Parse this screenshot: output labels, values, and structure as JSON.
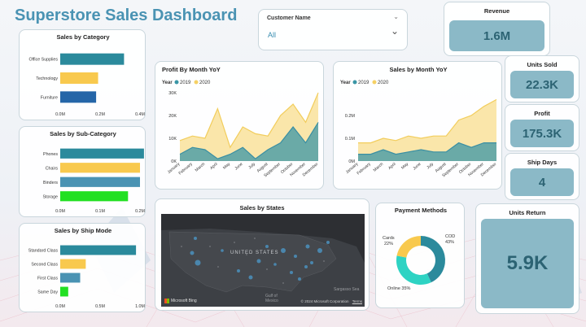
{
  "title": "Superstore Sales Dashboard",
  "filter": {
    "label": "Customer Name",
    "value": "All"
  },
  "kpis": {
    "revenue": {
      "label": "Revenue",
      "value": "1.6M"
    },
    "units_sold": {
      "label": "Units Sold",
      "value": "22.3K"
    },
    "profit": {
      "label": "Profit",
      "value": "175.3K"
    },
    "ship_days": {
      "label": "Ship Days",
      "value": "4"
    },
    "units_return": {
      "label": "Units Return",
      "value": "5.9K"
    }
  },
  "map": {
    "title": "Sales by States",
    "country_label": "UNITED STATES",
    "gulf_label": "Gulf of Mexico",
    "sea_label": "Sargasso Sea",
    "attribution": "© 2024 Microsoft Corporation",
    "terms": "Terms",
    "brand": "Microsoft Bing"
  },
  "colors": {
    "y2019": "#3a96a6",
    "y2020": "#f5d165",
    "teal": "#2b8a9c",
    "yellow": "#f8c94e",
    "blue": "#2566a8",
    "green": "#22e022",
    "accent": "#4a93b3"
  },
  "chart_data": [
    {
      "type": "bar",
      "orientation": "horizontal",
      "title": "Sales by Category",
      "categories": [
        "Office Supplies",
        "Technology",
        "Furniture"
      ],
      "values": [
        0.32,
        0.19,
        0.18
      ],
      "ticks": [
        "0.0M",
        "0.2M",
        "0.4M"
      ],
      "xlim": [
        0,
        0.4
      ]
    },
    {
      "type": "bar",
      "orientation": "horizontal",
      "title": "Sales by Sub-Category",
      "categories": [
        "Phones",
        "Chairs",
        "Binders",
        "Storage"
      ],
      "values": [
        0.21,
        0.2,
        0.2,
        0.17
      ],
      "ticks": [
        "0.0M",
        "0.1M",
        "0.2M"
      ],
      "xlim": [
        0,
        0.2
      ]
    },
    {
      "type": "bar",
      "orientation": "horizontal",
      "title": "Sales by Ship Mode",
      "categories": [
        "Standard Class",
        "Second Class",
        "First Class",
        "Same Day"
      ],
      "values": [
        0.95,
        0.32,
        0.25,
        0.1
      ],
      "ticks": [
        "0.0M",
        "0.5M",
        "1.0M"
      ],
      "xlim": [
        0,
        1
      ]
    },
    {
      "type": "area",
      "title": "Profit By Month YoY",
      "legend_title": "Year",
      "categories": [
        "January",
        "February",
        "March",
        "April",
        "May",
        "June",
        "July",
        "August",
        "September",
        "October",
        "November",
        "December"
      ],
      "series": [
        {
          "name": "2019",
          "values": [
            3000,
            6000,
            5000,
            1000,
            3000,
            6000,
            1000,
            5000,
            8000,
            15000,
            8000,
            17000
          ]
        },
        {
          "name": "2020",
          "values": [
            9000,
            11000,
            10000,
            23000,
            6000,
            15000,
            12000,
            11000,
            20000,
            25000,
            17000,
            30000
          ]
        }
      ],
      "ticks": [
        "0K",
        "10K",
        "20K",
        "30K"
      ],
      "ylim": [
        0,
        30000
      ]
    },
    {
      "type": "area",
      "title": "Sales by Month YoY",
      "legend_title": "Year",
      "categories": [
        "January",
        "February",
        "March",
        "April",
        "May",
        "June",
        "July",
        "August",
        "September",
        "October",
        "November",
        "December"
      ],
      "series": [
        {
          "name": "2019",
          "values": [
            30000,
            30000,
            50000,
            30000,
            40000,
            50000,
            40000,
            40000,
            80000,
            60000,
            80000,
            80000
          ]
        },
        {
          "name": "2020",
          "values": [
            80000,
            80000,
            100000,
            90000,
            110000,
            100000,
            110000,
            110000,
            180000,
            200000,
            240000,
            270000
          ]
        }
      ],
      "ticks": [
        "0M",
        "0.1M",
        "0.2M"
      ],
      "ylim": [
        0,
        300000
      ]
    },
    {
      "type": "pie",
      "donut": true,
      "title": "Payment Methods",
      "categories": [
        "COD",
        "Online",
        "Cards"
      ],
      "values": [
        43,
        35,
        22
      ],
      "labels": [
        "COD 43%",
        "Online 35%",
        "Cards 22%"
      ]
    }
  ]
}
